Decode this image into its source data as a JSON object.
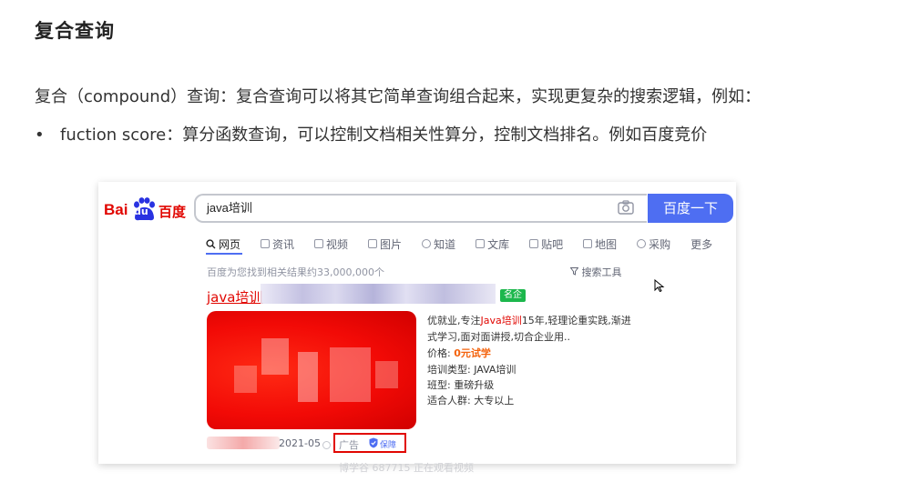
{
  "heading": "复合查询",
  "paragraph": "复合（compound）查询：复合查询可以将其它简单查询组合起来，实现更复杂的搜索逻辑，例如：",
  "bullet": {
    "marker": "•",
    "text": "fuction score：算分函数查询，可以控制文档相关性算分，控制文档排名。例如百度竞价"
  },
  "baidu": {
    "logo": {
      "bai": "Bai",
      "du": "du",
      "cn": "百度"
    },
    "search_value": "java培训",
    "search_button": "百度一下",
    "tabs": [
      {
        "label": "网页",
        "icon": "search-icon"
      },
      {
        "label": "资讯",
        "icon": "news-icon"
      },
      {
        "label": "视频",
        "icon": "video-icon"
      },
      {
        "label": "图片",
        "icon": "image-icon"
      },
      {
        "label": "知道",
        "icon": "question-icon"
      },
      {
        "label": "文库",
        "icon": "doc-icon"
      },
      {
        "label": "贴吧",
        "icon": "tieba-icon"
      },
      {
        "label": "地图",
        "icon": "map-icon"
      },
      {
        "label": "采购",
        "icon": "purchase-icon"
      },
      {
        "label": "更多",
        "icon": ""
      }
    ],
    "result_count": "百度为您找到相关结果约33,000,000个",
    "search_tools": "搜索工具",
    "result": {
      "title": "java培训",
      "badge": "名企",
      "desc_prefix": "优就业,专注",
      "desc_highlight": "Java培训",
      "desc_suffix": "15年,轻理论重实践,渐进式学习,面对面讲授,切合企业用..",
      "price_label": "价格:",
      "price_value": "0元试学",
      "type_label": "培训类型:",
      "type_value": "JAVA培训",
      "class_label": "班型:",
      "class_value": "重磅升级",
      "audience_label": "适合人群:",
      "audience_value": "大专以上",
      "date": "2021-05",
      "ad_label": "广告",
      "protect_label": "保障"
    },
    "colors": {
      "brand_red": "#e10601",
      "brand_blue": "#4e6ef2",
      "badge_green": "#1cb74c"
    }
  },
  "watermark": "博学谷 687715 正在观看视频"
}
